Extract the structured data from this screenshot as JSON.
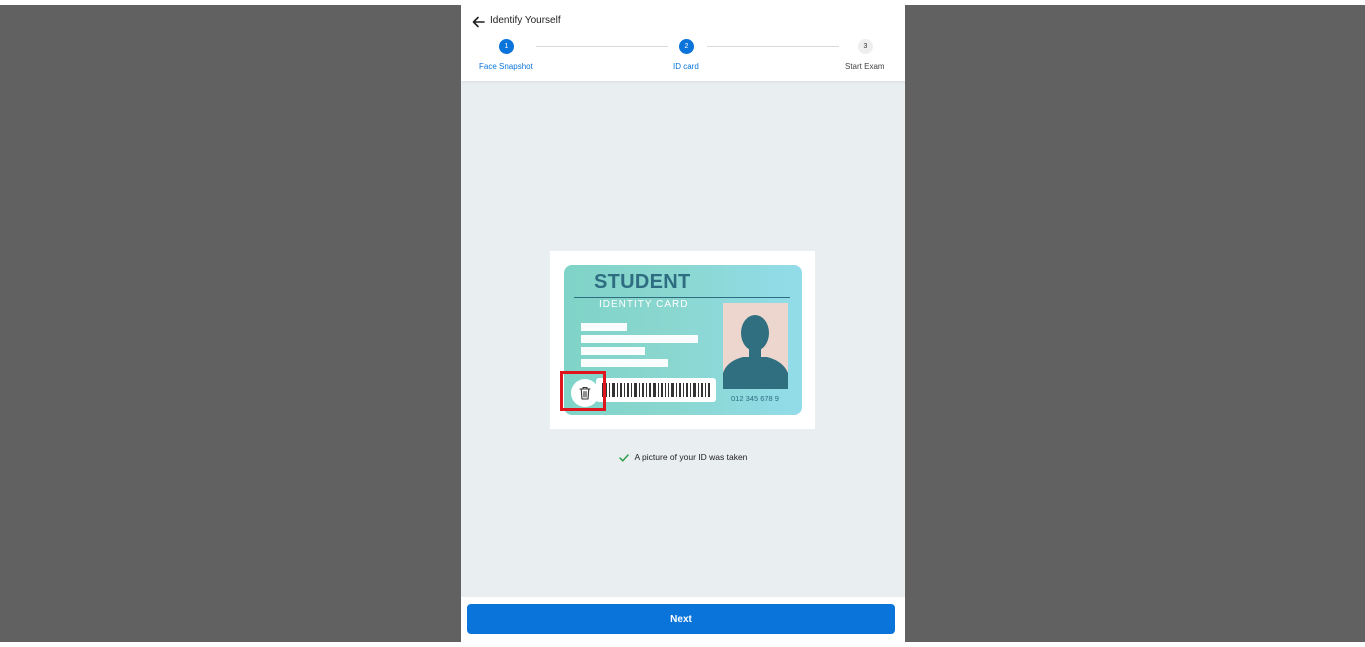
{
  "header": {
    "title": "Identify Yourself",
    "back_icon": "arrow-left-icon"
  },
  "stepper": {
    "steps": [
      {
        "number": "1",
        "label": "Face Snapshot",
        "state": "done"
      },
      {
        "number": "2",
        "label": "ID card",
        "state": "active"
      },
      {
        "number": "3",
        "label": "Start Exam",
        "state": "pending"
      }
    ]
  },
  "id_card": {
    "title": "STUDENT",
    "subtitle": "IDENTITY CARD",
    "number": "012 345 678 9",
    "delete_icon": "trash-icon"
  },
  "status": {
    "message": "A picture of your ID was taken",
    "icon": "check-icon"
  },
  "footer": {
    "next_label": "Next"
  },
  "colors": {
    "accent": "#0a74da",
    "backdrop": "#616161",
    "content_bg": "#e9eef1",
    "highlight": "#e0141c",
    "success": "#2e9e4b"
  }
}
